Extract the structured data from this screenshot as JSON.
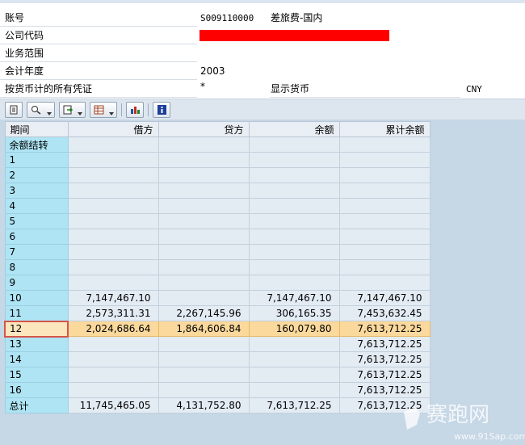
{
  "header": {
    "account_label": "账号",
    "account_value": "S009110000",
    "account_desc": "差旅费-国内",
    "company_code_label": "公司代码",
    "business_area_label": "业务范围",
    "fiscal_year_label": "会计年度",
    "fiscal_year_value": "2003",
    "all_docs_label": "按货币计的所有凭证",
    "all_docs_value": "*",
    "display_currency_label": "显示货币",
    "display_currency_value": "CNY"
  },
  "toolbar": {
    "buttons": [
      "print-icon",
      "details-icon",
      "export-icon",
      "layout-icon",
      "chart-icon",
      "info-icon"
    ]
  },
  "table": {
    "columns": [
      "期间",
      "借方",
      "贷方",
      "余额",
      "累计余额"
    ],
    "rows": [
      [
        "余额结转",
        "",
        "",
        "",
        ""
      ],
      [
        "1",
        "",
        "",
        "",
        ""
      ],
      [
        "2",
        "",
        "",
        "",
        ""
      ],
      [
        "3",
        "",
        "",
        "",
        ""
      ],
      [
        "4",
        "",
        "",
        "",
        ""
      ],
      [
        "5",
        "",
        "",
        "",
        ""
      ],
      [
        "6",
        "",
        "",
        "",
        ""
      ],
      [
        "7",
        "",
        "",
        "",
        ""
      ],
      [
        "8",
        "",
        "",
        "",
        ""
      ],
      [
        "9",
        "",
        "",
        "",
        ""
      ],
      [
        "10",
        "7,147,467.10",
        "",
        "7,147,467.10",
        "7,147,467.10"
      ],
      [
        "11",
        "2,573,311.31",
        "2,267,145.96",
        "306,165.35",
        "7,453,632.45"
      ],
      [
        "12",
        "2,024,686.64",
        "1,864,606.84",
        "160,079.80",
        "7,613,712.25"
      ],
      [
        "13",
        "",
        "",
        "",
        "7,613,712.25"
      ],
      [
        "14",
        "",
        "",
        "",
        "7,613,712.25"
      ],
      [
        "15",
        "",
        "",
        "",
        "7,613,712.25"
      ],
      [
        "16",
        "",
        "",
        "",
        "7,613,712.25"
      ],
      [
        "总计",
        "11,745,465.05",
        "4,131,752.80",
        "7,613,712.25",
        "7,613,712.25"
      ]
    ],
    "selected_row": "12"
  },
  "watermark": {
    "text": "赛跑网",
    "url": "www.91Sap.com"
  },
  "colors": {
    "grid_background": "#c6d7e6",
    "key_column": "#aee4f4",
    "selected_row": "#fbd99c",
    "redaction": "#ff0000"
  }
}
